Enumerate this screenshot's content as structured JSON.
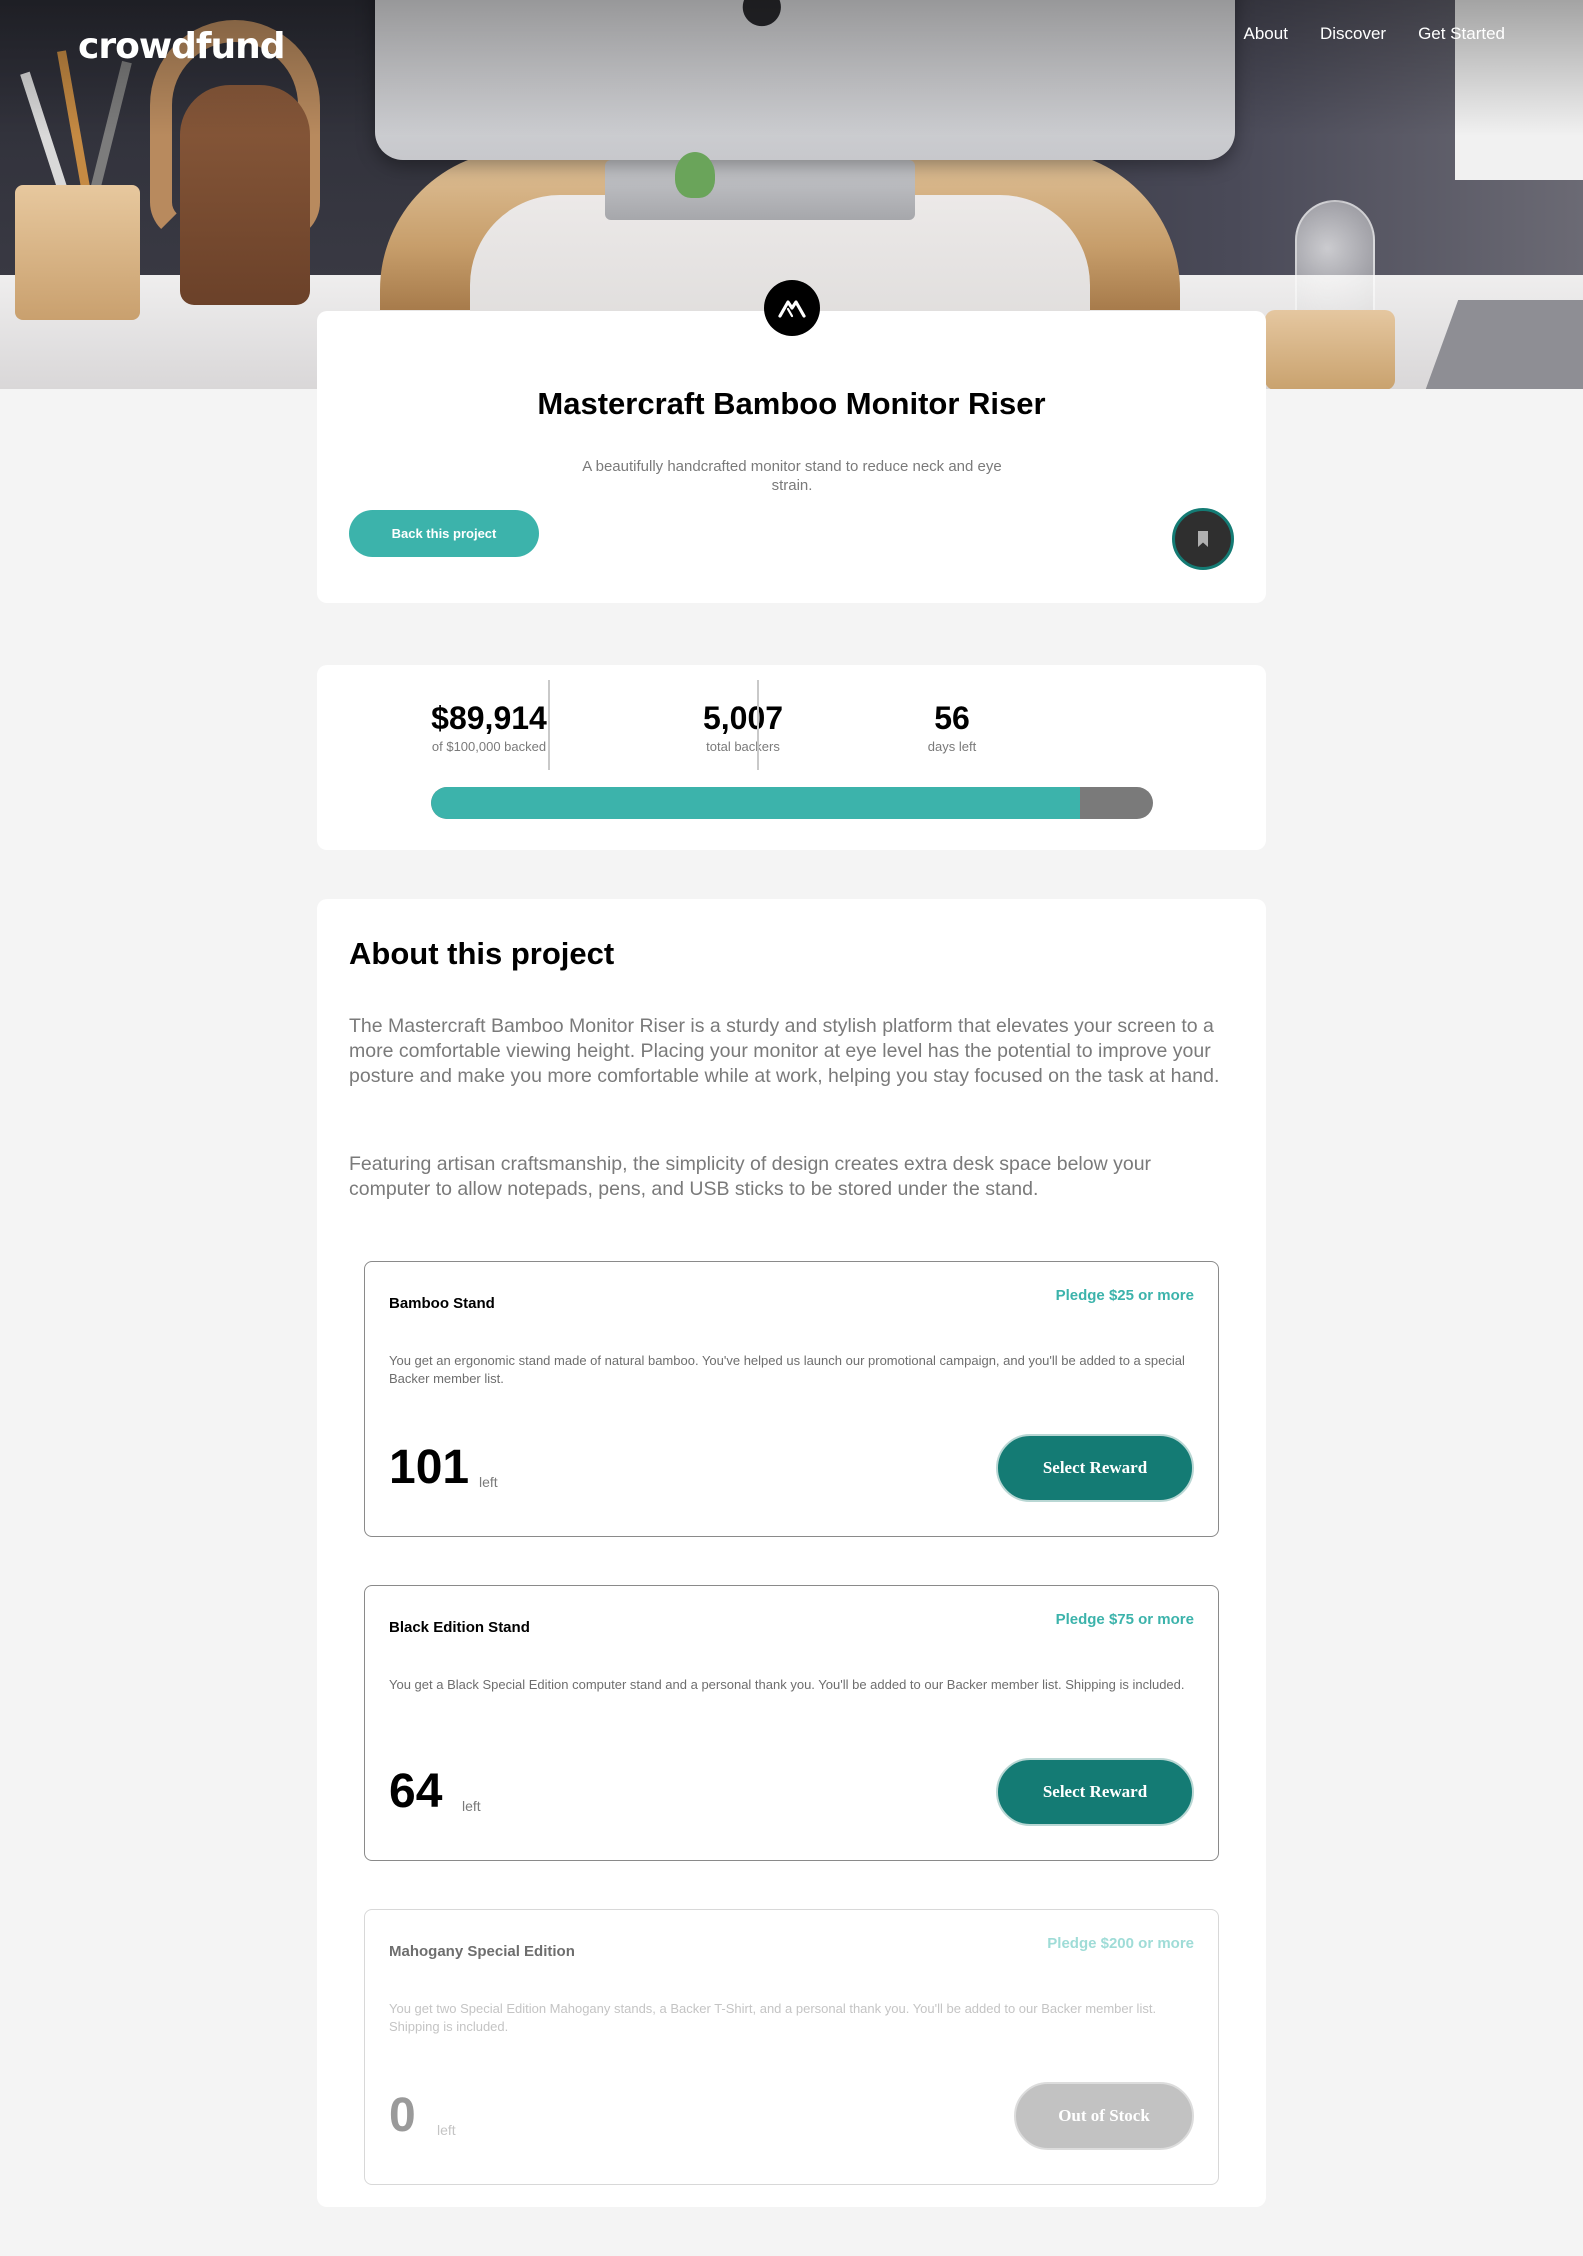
{
  "header": {
    "logo": "crowdfund",
    "nav": [
      "About",
      "Discover",
      "Get Started"
    ]
  },
  "project": {
    "title": "Mastercraft Bamboo Monitor Riser",
    "description": "A beautifully handcrafted monitor stand to reduce neck and eye strain.",
    "back_button": "Back this project",
    "logo_icon": "mastercraft-logo-icon",
    "bookmark_icon": "bookmark-icon"
  },
  "stats": {
    "backed_amount": "$89,914",
    "backed_label": "of $100,000 backed",
    "backers": "5,007",
    "backers_label": "total backers",
    "days": "56",
    "days_label": "days left",
    "progress_fraction": 0.899
  },
  "about": {
    "title": "About this project",
    "paragraphs": [
      "The Mastercraft Bamboo Monitor Riser is a sturdy and stylish platform that elevates your screen to a more comfortable viewing height. Placing your monitor at eye level has the potential to improve your posture and make you more comfortable while at work, helping you stay focused on the task at hand.",
      "Featuring artisan craftsmanship, the simplicity of design creates extra desk space below your computer to allow notepads, pens, and USB sticks to be stored under the stand."
    ]
  },
  "rewards": [
    {
      "name": "Bamboo Stand",
      "pledge": "Pledge $25 or more",
      "description": "You get an ergonomic stand made of natural bamboo. You've helped us launch our promotional campaign, and you'll be added to a special Backer member list.",
      "count": "101",
      "left_label": "left",
      "button": "Select Reward"
    },
    {
      "name": "Black Edition Stand",
      "pledge": "Pledge $75 or more",
      "description": "You get a Black Special Edition computer stand and a personal thank you. You'll be added to our Backer  member list. Shipping is included.",
      "count": "64",
      "left_label": "left",
      "button": "Select Reward"
    },
    {
      "name": "Mahogany Special Edition",
      "pledge": "Pledge $200 or more",
      "description": "You get two Special Edition Mahogany stands, a Backer T-Shirt, and a personal thank you. You'll be added  to our Backer member list. Shipping is included.",
      "count": "0",
      "left_label": "left",
      "button": "Out of Stock"
    }
  ],
  "colors": {
    "accent": "#3cb3ab",
    "accent_dark": "#147b74",
    "muted": "#7a7a7a",
    "background": "#f4f4f4"
  }
}
